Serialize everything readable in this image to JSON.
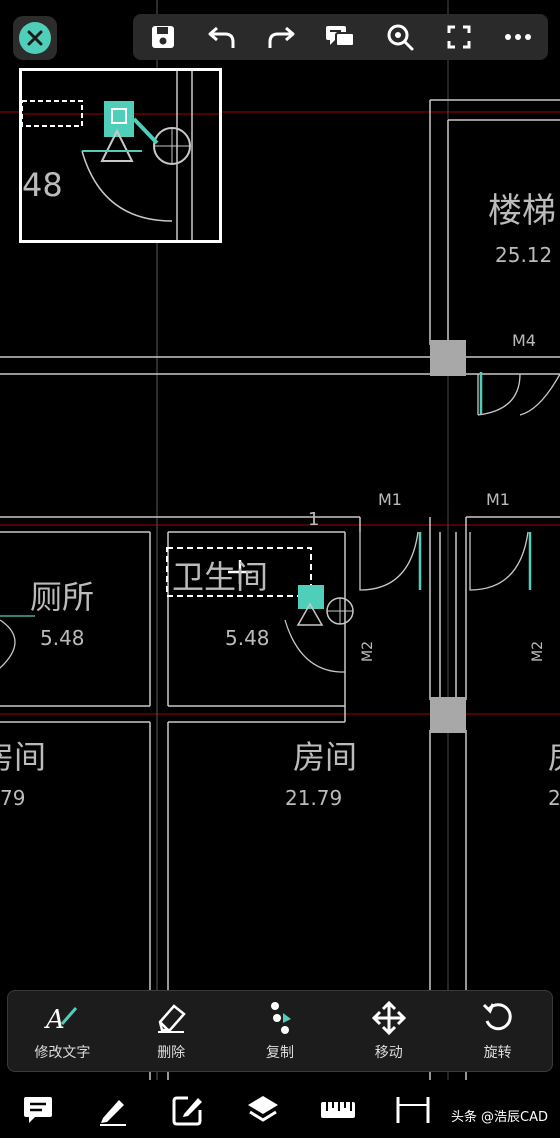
{
  "toolbar": {
    "close": "close-icon",
    "items": [
      "save-icon",
      "undo-icon",
      "redo-icon",
      "comment-icon",
      "zoom-icon",
      "fullscreen-icon",
      "more-icon"
    ]
  },
  "drawing": {
    "rooms": [
      {
        "name": "楼梯",
        "area": "25.12"
      },
      {
        "name": "厕所",
        "area": "5.48"
      },
      {
        "name": "卫生间",
        "area": "5.48"
      },
      {
        "name": "房间",
        "area": "21.79"
      },
      {
        "name": "房间",
        "area": "21.79"
      }
    ],
    "doors": [
      "M4",
      "M1",
      "M1",
      "M2",
      "M2"
    ],
    "marker": "1",
    "minimap_partial_text": "48",
    "edge_fragments": [
      "房间",
      "79",
      "房",
      "2"
    ]
  },
  "actions": [
    {
      "label": "修改文字",
      "icon": "edit-text-icon"
    },
    {
      "label": "删除",
      "icon": "eraser-icon"
    },
    {
      "label": "复制",
      "icon": "copy-icon"
    },
    {
      "label": "移动",
      "icon": "move-icon"
    },
    {
      "label": "旋转",
      "icon": "rotate-icon"
    }
  ],
  "bottom_tools": [
    "comment-icon",
    "pencil-icon",
    "edit-box-icon",
    "layers-icon",
    "ruler-icon",
    "dimension-icon"
  ],
  "watermark": {
    "prefix": "头条",
    "handle": "@浩辰CAD"
  },
  "colors": {
    "accent": "#4fcfb9",
    "wall": "#c8c8c8",
    "axis": "#8b0000",
    "selection": "#ffffff"
  }
}
